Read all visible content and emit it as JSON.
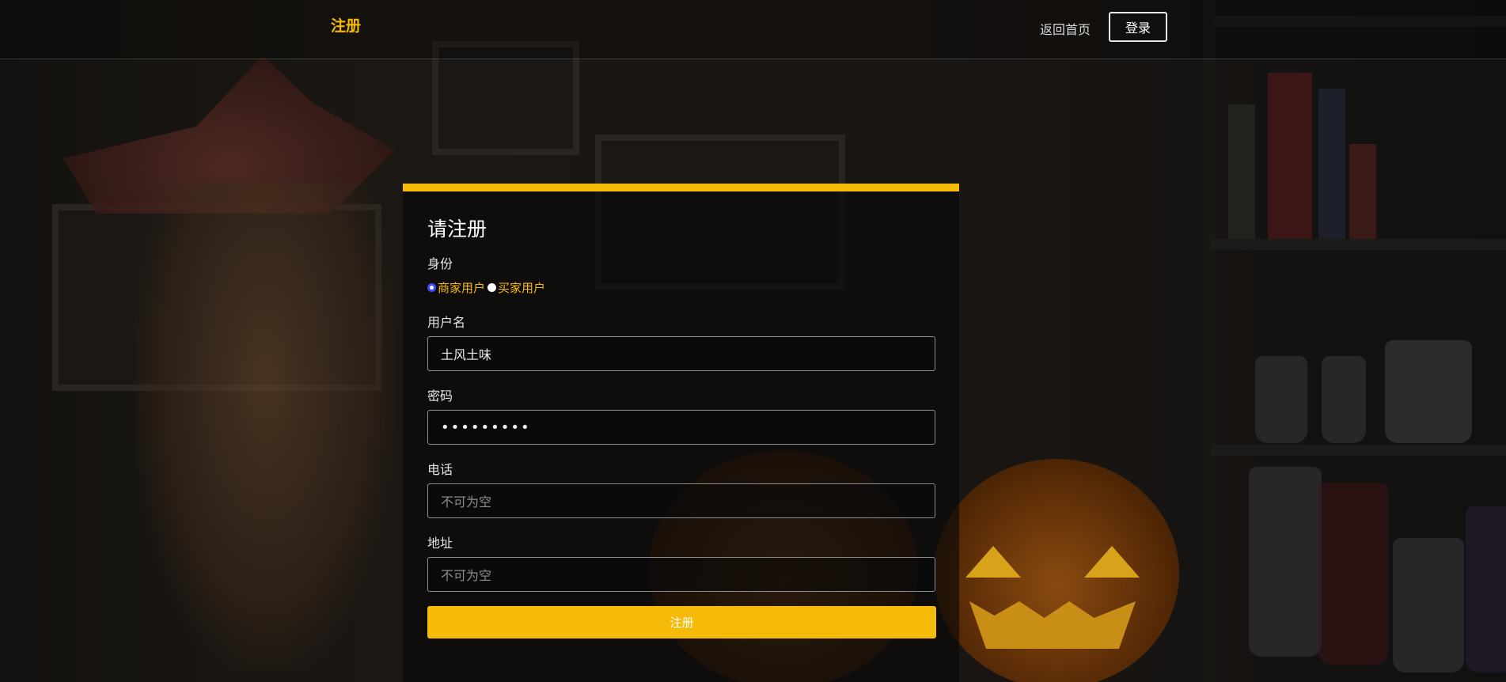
{
  "header": {
    "brand": "注册",
    "home_link": "返回首页",
    "login_button": "登录"
  },
  "form": {
    "title": "请注册",
    "role": {
      "label": "身份",
      "options": [
        {
          "label": "商家用户",
          "checked": true
        },
        {
          "label": "买家用户",
          "checked": false
        }
      ]
    },
    "username": {
      "label": "用户名",
      "value": "土风土味"
    },
    "password": {
      "label": "密码",
      "value": "•••••••••"
    },
    "phone": {
      "label": "电话",
      "placeholder": "不可为空"
    },
    "address": {
      "label": "地址",
      "placeholder": "不可为空"
    },
    "submit_label": "注册"
  },
  "colors": {
    "accent": "#f6bb08",
    "radio_checked": "#3b4bff"
  }
}
